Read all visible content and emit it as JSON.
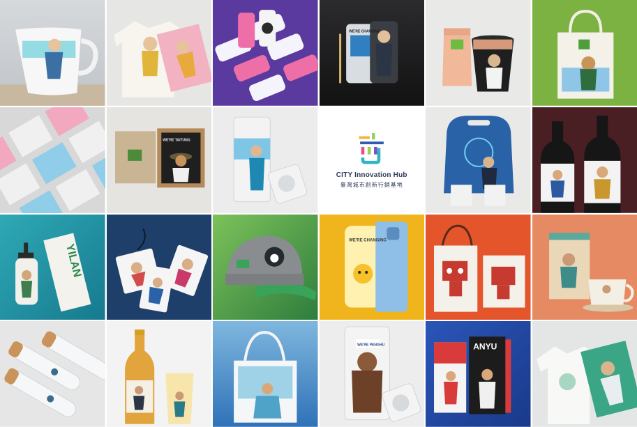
{
  "collage": {
    "center_logo": {
      "title": "CITY Innovation Hub",
      "subtitle": "臺灣城市創新行銷基地"
    },
    "tags": {
      "were_changing": "WE'RE CHANGING",
      "were_taitung": "WE'RE TAITUNG",
      "were_penghu": "WE'RE PENGHU",
      "anyu": "ANYU",
      "yilan": "YILAN"
    },
    "colors": {
      "purple": "#5b3aa0",
      "green": "#7cb241",
      "teal": "#1f8fa0",
      "navy": "#1e3f6a",
      "yellow": "#f0b51c",
      "orange": "#e4552b",
      "coral": "#e68a63",
      "wine": "#4a1f24"
    }
  }
}
